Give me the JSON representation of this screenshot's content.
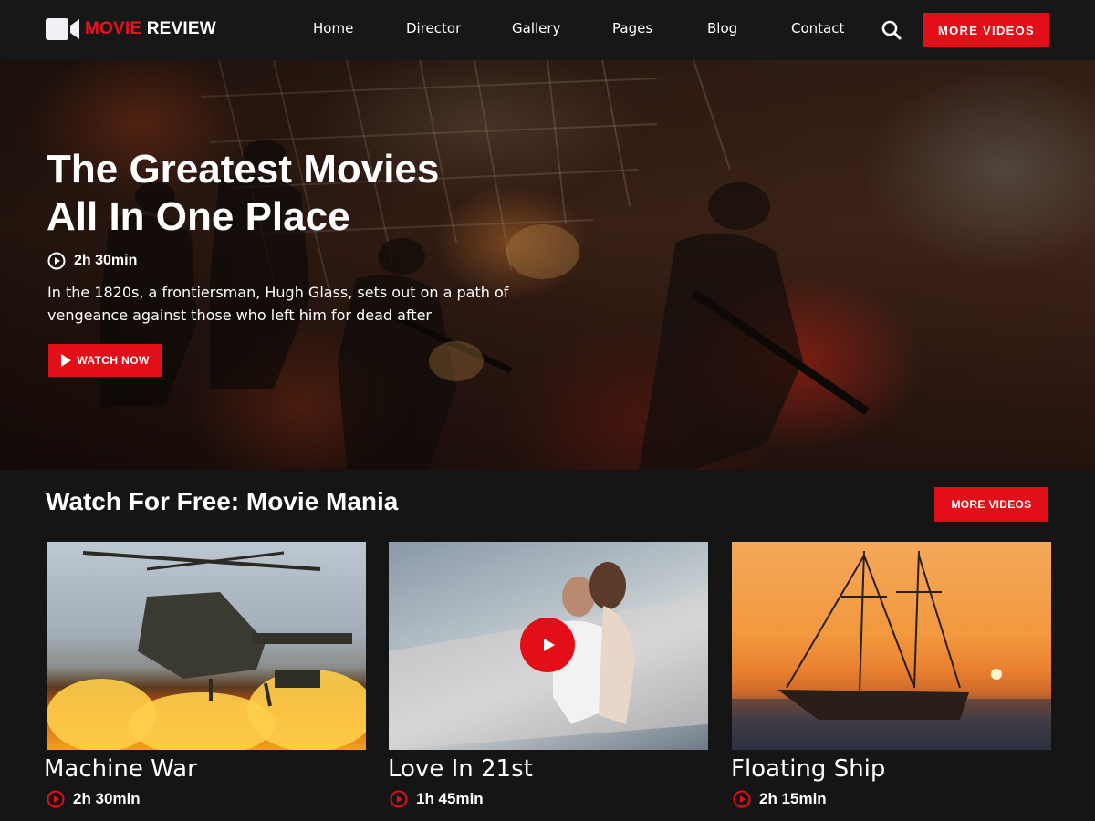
{
  "brand": {
    "name_red": "MOVIE",
    "name_white": " REVIEW",
    "accent": "#e20f18",
    "logo_icon": "video-camera-icon"
  },
  "nav": {
    "links": [
      "Home",
      "Director",
      "Gallery",
      "Pages",
      "Blog",
      "Contact"
    ],
    "search_icon": "search-icon",
    "cta_label": "MORE VIDEOS"
  },
  "hero": {
    "title_line1": "The Greatest Movies",
    "title_line2": "All In One Place",
    "duration": "2h 30min",
    "description": "In the 1820s, a frontiersman, Hugh Glass, sets out on a path of vengeance against those who left him for dead after",
    "cta_label": "WATCH NOW"
  },
  "section": {
    "title": "Watch For Free: Movie Mania",
    "cta_label": "MORE VIDEOS"
  },
  "movies": [
    {
      "title": "Machine War",
      "duration": "2h 30min"
    },
    {
      "title": "Love In 21st",
      "duration": "1h 45min"
    },
    {
      "title": "Floating Ship",
      "duration": "2h 15min"
    }
  ]
}
